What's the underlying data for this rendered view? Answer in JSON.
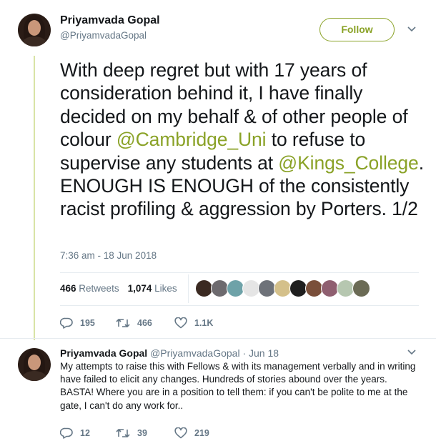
{
  "main_tweet": {
    "author_name": "Priyamvada Gopal",
    "author_handle": "@PriyamvadaGopal",
    "follow_label": "Follow",
    "text_part1": "With deep regret but with 17 years of consideration behind it, I have finally decided on my behalf & of other people of colour ",
    "mention1": "@Cambridge_Uni",
    "text_part2": " to refuse to supervise any students at ",
    "mention2": "@Kings_College",
    "text_part3": ". ENOUGH IS ENOUGH of the consistently racist profiling & aggression by Porters. 1/2",
    "timestamp": "7:36 am - 18 Jun 2018",
    "retweets_count": "466",
    "retweets_label": "Retweets",
    "likes_count": "1,074",
    "likes_label": "Likes",
    "liker_avatars": [
      "#3b2a22",
      "#6d6a6e",
      "#6ea2a8",
      "#e5e5e5",
      "#6e7279",
      "#d4c08a",
      "#1f1f1f",
      "#7a4f3a",
      "#8f5f70",
      "#b6c7b0",
      "#6b6b55"
    ],
    "actions": {
      "replies": "195",
      "retweets": "466",
      "likes": "1.1K"
    }
  },
  "reply_tweet": {
    "author_name": "Priyamvada Gopal",
    "author_handle": "@PriyamvadaGopal",
    "dot": "·",
    "date": "Jun 18",
    "text": "My attempts to raise this with Fellows & with its management verbally and in writing have failed to elicit any changes.  Hundreds of stories abound over the years. BASTA! Where you are in a position to tell them: if you can't be polite to me at the gate, I can't do any work for..",
    "actions": {
      "replies": "12",
      "retweets": "39",
      "likes": "219"
    }
  },
  "colors": {
    "accent": "#8aa227",
    "muted": "#657786",
    "text": "#14171a",
    "thread_line": "#d8e3a6"
  },
  "icons": [
    "reply-icon",
    "retweet-icon",
    "heart-icon",
    "chevron-down-icon"
  ]
}
